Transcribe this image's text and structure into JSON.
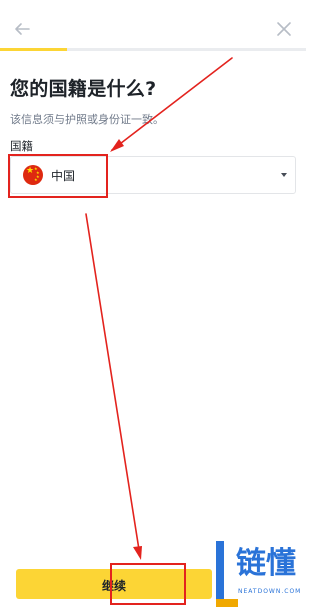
{
  "colors": {
    "accent": "#fcd535",
    "annotation_red": "#e3231e",
    "text": "#1e2329",
    "muted": "#707a8a"
  },
  "header": {
    "back_icon": "arrow-left-icon",
    "close_icon": "close-icon"
  },
  "progress": {
    "value": 0.22
  },
  "page": {
    "title": "您的国籍是什么?",
    "subtitle": "该信息须与护照或身份证一致。"
  },
  "nationality": {
    "label": "国籍",
    "value": "中国",
    "flag_icon": "china-flag-icon"
  },
  "actions": {
    "continue_label": "继续"
  },
  "watermark": {
    "brand": "链懂",
    "domain": "NEATDOWN.COM"
  }
}
